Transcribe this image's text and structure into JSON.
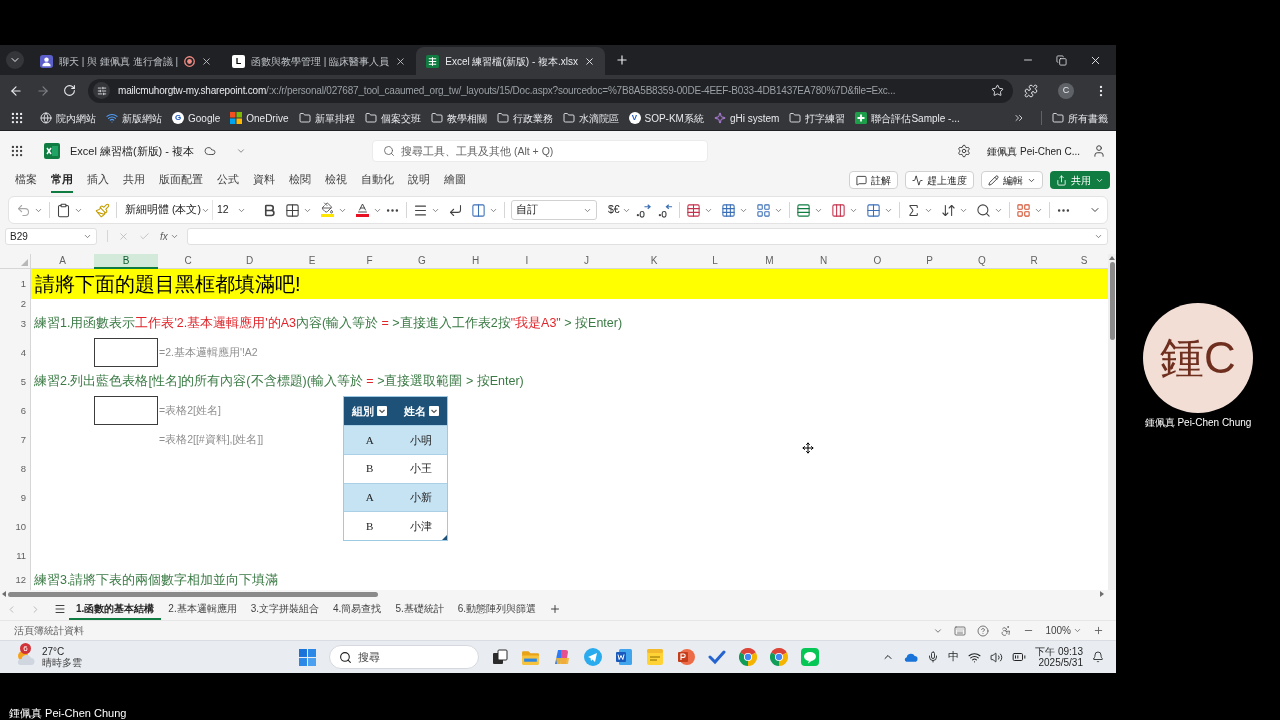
{
  "browser": {
    "tabs": [
      {
        "title": "聊天 | 與 鍾佩真 進行會議 |",
        "kind": "chat",
        "selected": false,
        "recording": true
      },
      {
        "title": "函數與教學管理 | 臨床醫事人員",
        "kind": "letter",
        "favicon_text": "L",
        "selected": false,
        "recording": false
      },
      {
        "title": "Excel 練習檔(新版) - 複本.xlsx",
        "kind": "spreadsheet",
        "selected": true,
        "recording": false
      }
    ],
    "address": {
      "host": "mailcmuhorgtw-my.sharepoint.com",
      "path": "/:x:/r/personal/027687_tool_caaumed_org_tw/_layouts/15/Doc.aspx?sourcedoc=%7B8A5B8359-00DE-4EEF-B033-4DB1437EA780%7D&file=Exc..."
    },
    "profile_initial": "C",
    "bookmarks": [
      {
        "label": "院內網站",
        "kind": "globe"
      },
      {
        "label": "新版網站",
        "kind": "signal"
      },
      {
        "label": "Google",
        "kind": "letter",
        "icon_text": "G"
      },
      {
        "label": "OneDrive",
        "kind": "tiles"
      },
      {
        "label": "新單排程",
        "kind": "folder"
      },
      {
        "label": "個案交班",
        "kind": "folder"
      },
      {
        "label": "教學相關",
        "kind": "folder"
      },
      {
        "label": "行政業務",
        "kind": "folder"
      },
      {
        "label": "水滴院區",
        "kind": "folder"
      },
      {
        "label": "SOP-KM系統",
        "kind": "letter",
        "icon_text": "V"
      },
      {
        "label": "gHi system",
        "kind": "sparkle"
      },
      {
        "label": "打字練習",
        "kind": "folder"
      },
      {
        "label": "聯合評估Sample -...",
        "kind": "plus"
      }
    ],
    "all_bookmarks": "所有書籤"
  },
  "excel": {
    "file_title": "Excel 練習檔(新版) - 複本",
    "search_placeholder": "搜尋工具、工具及其他 (Alt + Q)",
    "user_name": "鍾佩真 Pei-Chen C...",
    "ribbon_tabs": [
      {
        "label": "檔案",
        "selected": false
      },
      {
        "label": "常用",
        "selected": true
      },
      {
        "label": "插入",
        "selected": false
      },
      {
        "label": "共用",
        "selected": false
      },
      {
        "label": "版面配置",
        "selected": false
      },
      {
        "label": "公式",
        "selected": false
      },
      {
        "label": "資料",
        "selected": false
      },
      {
        "label": "檢閱",
        "selected": false
      },
      {
        "label": "檢視",
        "selected": false
      },
      {
        "label": "自動化",
        "selected": false
      },
      {
        "label": "說明",
        "selected": false
      },
      {
        "label": "繪圖",
        "selected": false
      }
    ],
    "actions": [
      {
        "label": "註解",
        "kind": "comment"
      },
      {
        "label": "趕上進度",
        "kind": "catch_up"
      },
      {
        "label": "編輯",
        "kind": "edit"
      },
      {
        "label": "共用",
        "kind": "share"
      }
    ],
    "toolbar": {
      "font": "新細明體 (本文)",
      "font_size": "12",
      "number_format": "自訂",
      "currency": "$€"
    },
    "formula_bar": {
      "name_box": "B29",
      "function_label": "fx"
    },
    "sheet": {
      "columns": [
        {
          "label": "A",
          "selected": false
        },
        {
          "label": "B",
          "selected": true
        },
        {
          "label": "C",
          "selected": false
        },
        {
          "label": "D",
          "selected": false
        },
        {
          "label": "E",
          "selected": false
        },
        {
          "label": "F",
          "selected": false
        },
        {
          "label": "G",
          "selected": false
        },
        {
          "label": "H",
          "selected": false
        },
        {
          "label": "I",
          "selected": false
        },
        {
          "label": "J",
          "selected": false
        },
        {
          "label": "K",
          "selected": false
        },
        {
          "label": "L",
          "selected": false
        },
        {
          "label": "M",
          "selected": false
        },
        {
          "label": "N",
          "selected": false
        },
        {
          "label": "O",
          "selected": false
        },
        {
          "label": "P",
          "selected": false
        },
        {
          "label": "Q",
          "selected": false
        },
        {
          "label": "R",
          "selected": false
        },
        {
          "label": "S",
          "selected": false
        }
      ],
      "row_numbers": [
        "1",
        "2",
        "3",
        "4",
        "5",
        "6",
        "7",
        "8",
        "9",
        "10",
        "11",
        "12"
      ],
      "banner": "請將下面的題目黑框都填滿吧!",
      "exercises": [
        {
          "instruction": [
            {
              "text": "練習1.用函數表示",
              "highlighted": false
            },
            {
              "text": "工作表'2.基本邏輯應用'的A3",
              "highlighted": true
            },
            {
              "text": "內容(輸入等於 ",
              "highlighted": false
            },
            {
              "text": "=",
              "highlighted": true
            },
            {
              "text": " >直接進入工作表2按",
              "highlighted": false
            },
            {
              "text": "\"我是A3\"",
              "highlighted": true
            },
            {
              "text": " > 按Enter)",
              "highlighted": false
            }
          ],
          "answer_box": true,
          "hints": [
            "=2.基本邏輯應用'!A2"
          ]
        },
        {
          "instruction": [
            {
              "text": "練習2.列出藍色表格[性名]的所有內容(不含標題)(輸入等於 ",
              "highlighted": false
            },
            {
              "text": "=",
              "highlighted": true
            },
            {
              "text": " >直接選取範圍 > 按Enter)",
              "highlighted": false
            }
          ],
          "answer_box": true,
          "hints": [
            "=表格2[姓名]",
            "=表格2[[#資料],[姓名]]"
          ]
        },
        {
          "instruction": [
            {
              "text": "練習3.請將下表的兩個數字相加並向下填滿",
              "highlighted": false
            }
          ]
        }
      ],
      "name_table": {
        "columns": [
          "組別",
          "姓名"
        ],
        "rows": [
          [
            "A",
            "小明"
          ],
          [
            "B",
            "小王"
          ],
          [
            "A",
            "小新"
          ],
          [
            "B",
            "小津"
          ]
        ]
      }
    },
    "sheet_tabs": [
      {
        "label": "1.函數的基本結構",
        "selected": true
      },
      {
        "label": "2.基本邏輯應用",
        "selected": false
      },
      {
        "label": "3.文字拼裝組合",
        "selected": false
      },
      {
        "label": "4.簡易查找",
        "selected": false
      },
      {
        "label": "5.基礎統計",
        "selected": false
      },
      {
        "label": "6.動態陣列與篩選",
        "selected": false
      }
    ],
    "status_bar": {
      "text": "活頁簿統計資料",
      "zoom": "100%"
    }
  },
  "taskbar": {
    "weather": {
      "badge": "6",
      "temperature": "27°C",
      "condition": "晴時多雲"
    },
    "search_placeholder": "搜尋",
    "input_method": "中",
    "time": "下午 09:13",
    "date": "2025/5/31"
  },
  "meeting": {
    "participant": {
      "initials": "鍾C",
      "name": "鍾佩真 Pei-Chen Chung"
    },
    "presenter_name": "鍾佩真 Pei-Chen Chung"
  }
}
